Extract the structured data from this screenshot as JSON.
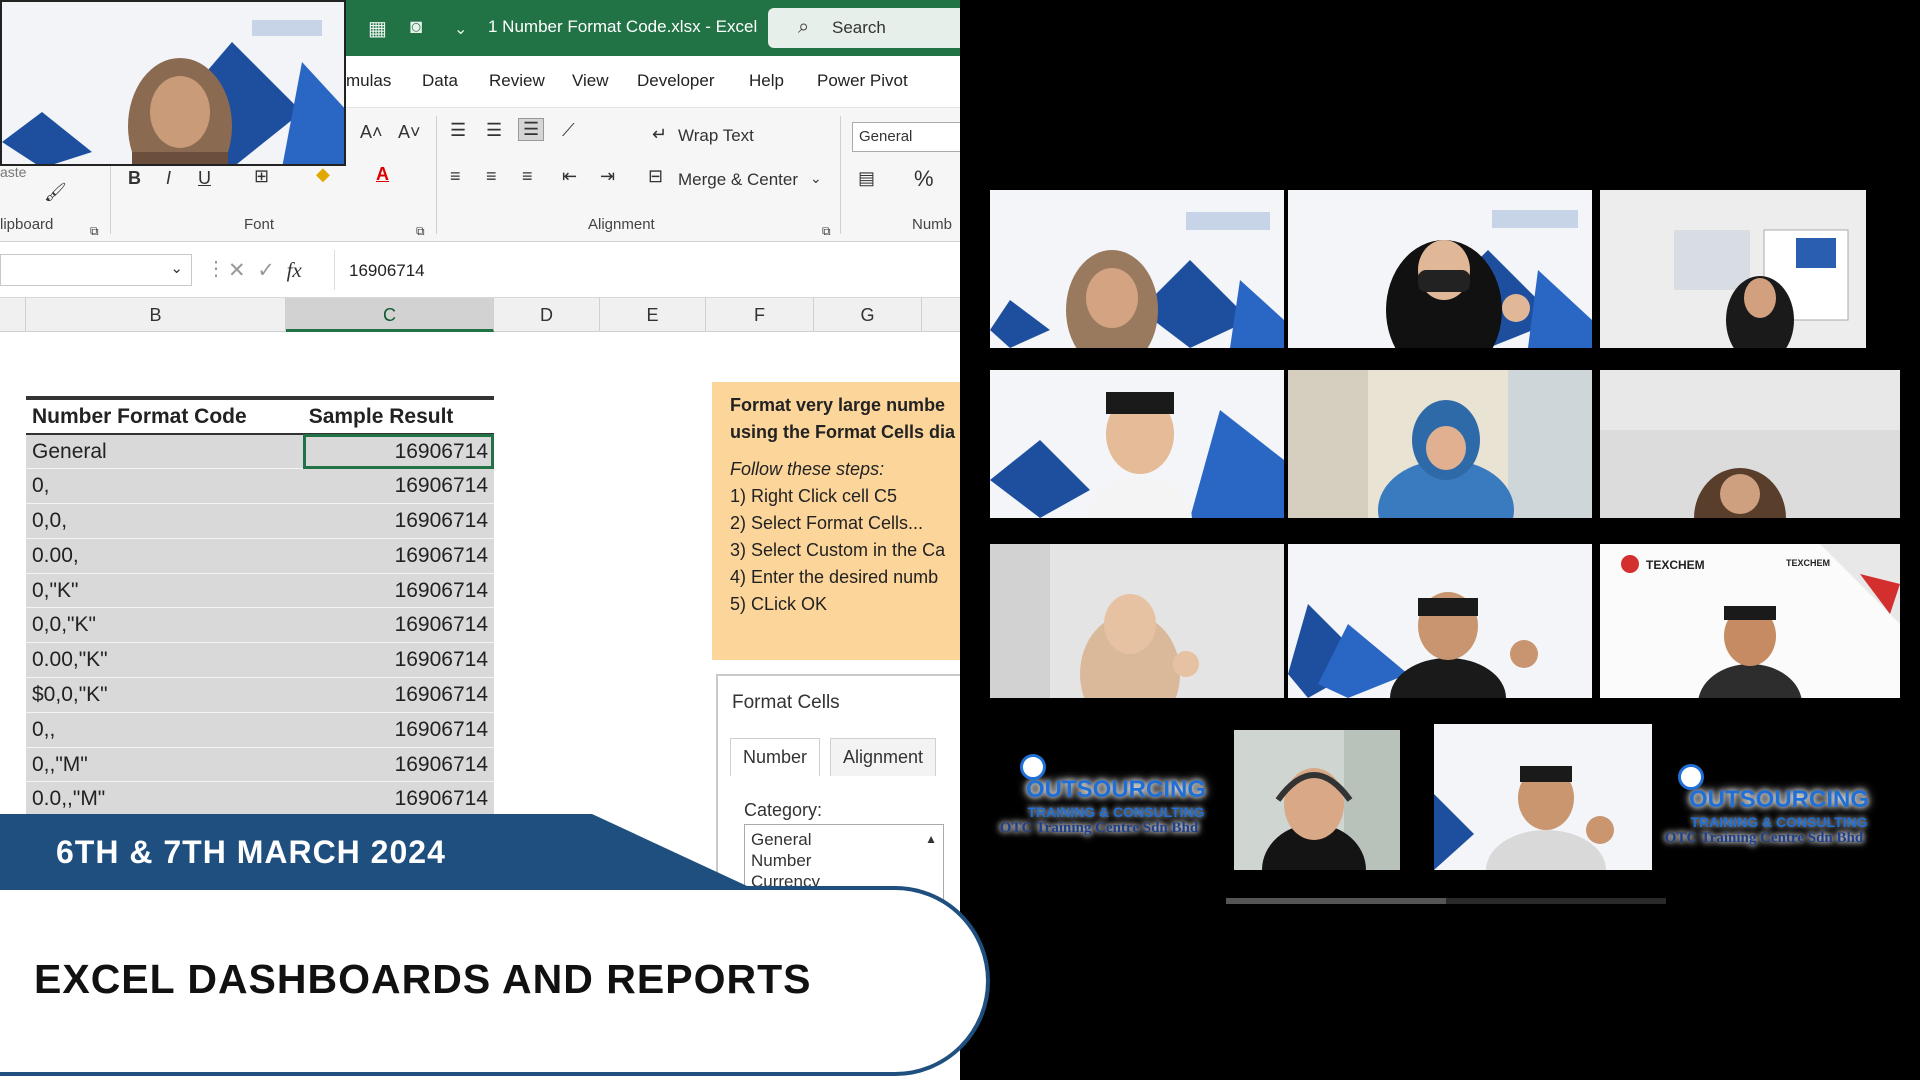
{
  "excel": {
    "filename": "1 Number Format Code.xlsx  -  Excel",
    "search_placeholder": "Search",
    "menu": [
      "mulas",
      "Data",
      "Review",
      "View",
      "Developer",
      "Help",
      "Power Pivot"
    ],
    "ribbon": {
      "paste_label": "aste",
      "clipboard_label": "lipboard",
      "font_label": "Font",
      "alignment_label": "Alignment",
      "number_label": "Numb",
      "wrap_text": "Wrap Text",
      "merge_center": "Merge & Center",
      "number_format": "General",
      "bold": "B",
      "italic": "I",
      "underline": "U",
      "percent": "%"
    },
    "formula_value": "16906714",
    "fx": "fx",
    "columns": [
      "B",
      "C",
      "D",
      "E",
      "F",
      "G"
    ],
    "selected_column": "C",
    "table": {
      "headers": [
        "Number Format Code",
        "Sample Result"
      ],
      "rows": [
        {
          "code": "General",
          "result": "16906714"
        },
        {
          "code": "0,",
          "result": "16906714"
        },
        {
          "code": "0,0,",
          "result": "16906714"
        },
        {
          "code": "0.00,",
          "result": "16906714"
        },
        {
          "code": "0,\"K\"",
          "result": "16906714"
        },
        {
          "code": "0,0,\"K\"",
          "result": "16906714"
        },
        {
          "code": "0.00,\"K\"",
          "result": "16906714"
        },
        {
          "code": "$0,0,\"K\"",
          "result": "16906714"
        },
        {
          "code": "0,,",
          "result": "16906714"
        },
        {
          "code": "0,,\"M\"",
          "result": "16906714"
        },
        {
          "code": "0.0,,\"M\"",
          "result": "16906714"
        }
      ]
    },
    "instructions": {
      "title_line1": "Format very large numbe",
      "title_line2": "using the Format Cells dia",
      "follow": "Follow these steps:",
      "steps": [
        "1) Right Click cell C5",
        "2) Select Format Cells...",
        "3) Select Custom in the Ca",
        "4) Enter the desired numb",
        "5) CLick OK"
      ]
    },
    "format_cells": {
      "title": "Format Cells",
      "tabs": [
        "Number",
        "Alignment"
      ],
      "category_label": "Category:",
      "categories": [
        "General",
        "Number",
        "Currency"
      ]
    }
  },
  "banner": {
    "date": "6TH & 7TH MARCH 2024",
    "title": "EXCEL DASHBOARDS AND REPORTS"
  },
  "branding": {
    "logo_main": "OUTSOURCING",
    "logo_sub": "TRAINING & CONSULTING",
    "logo_company": "OTC Training Centre Sdn Bhd",
    "texchem": "TEXCHEM"
  },
  "colors": {
    "excel_green": "#217346",
    "banner_blue": "#1e4f7f",
    "instruction_bg": "#fcd59b",
    "brand_blue": "#1f6fd6"
  }
}
